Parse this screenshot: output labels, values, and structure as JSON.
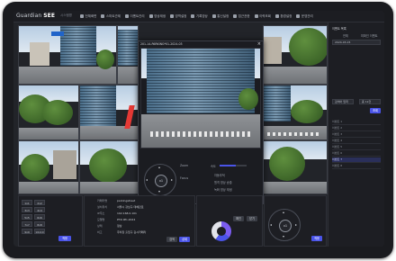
{
  "header": {
    "logo_prefix": "Guardian ",
    "logo_suffix": "SEE",
    "system_label": "시스템명",
    "menu": [
      {
        "label": "전체화면",
        "icon": "grid-icon"
      },
      {
        "label": "스마트관제",
        "icon": "pin-icon"
      },
      {
        "label": "이벤트관리",
        "icon": "bell-icon"
      },
      {
        "label": "영상재생",
        "icon": "film-icon"
      },
      {
        "label": "영역설정",
        "icon": "area-icon"
      },
      {
        "label": "기록영상",
        "icon": "record-icon"
      },
      {
        "label": "통신설정",
        "icon": "wrench-icon"
      },
      {
        "label": "접근권한",
        "icon": "lock-icon"
      },
      {
        "label": "이력조회",
        "icon": "doc-icon"
      },
      {
        "label": "환경설정",
        "icon": "gear-icon"
      },
      {
        "label": "운영관리",
        "icon": "user-icon"
      }
    ]
  },
  "popup": {
    "title": "201-14-PARKING*01-2024-03",
    "ptz_center": "x1",
    "zoom_label": "Zoom",
    "focus_label": "Focus",
    "preset_button": "프리셋",
    "speed_label": "속도",
    "options": [
      "자동추적",
      "원격 영상 송출",
      "녹화 영상 재생"
    ],
    "record_button": "영상 녹화 및 저장",
    "confirm_button": "확인",
    "cancel_button": "닫기"
  },
  "bottom_panel": {
    "layouts": [
      "1x1",
      "2x2",
      "3x3",
      "4x4",
      "5x5",
      "6x6",
      "7x7",
      "8x8",
      "9x9",
      "10x10"
    ],
    "apply_button": "적용",
    "info_rows": [
      {
        "label": "카메라명",
        "value": "parkingstreet"
      },
      {
        "label": "설치위치",
        "value": "서울시 강남구 테헤란로"
      },
      {
        "label": "IP주소",
        "value": "192.168.0.101"
      },
      {
        "label": "모델명",
        "value": "PTZ-IPC-2024"
      },
      {
        "label": "상태",
        "value": "정상"
      },
      {
        "label": "비고",
        "value": "주차장 출입구 감시카메라"
      }
    ],
    "search_button": "검색",
    "detail_button": "상세",
    "ptz_center": "x1"
  },
  "right_panel": {
    "title": "이벤트 목록",
    "filter_all": "전체",
    "filter_recent": "미확인 이벤트",
    "date": "2024-03-15",
    "search_label": "검색어 입력",
    "count_label": "총 12건",
    "apply_button": "조회",
    "items": [
      "이벤트 1",
      "이벤트 2",
      "이벤트 3",
      "이벤트 4",
      "이벤트 5",
      "이벤트 6",
      "이벤트 7",
      "이벤트 8"
    ],
    "highlight_item": "선택"
  },
  "colors": {
    "accent": "#4a54e8",
    "red_marker": "#e53935"
  }
}
